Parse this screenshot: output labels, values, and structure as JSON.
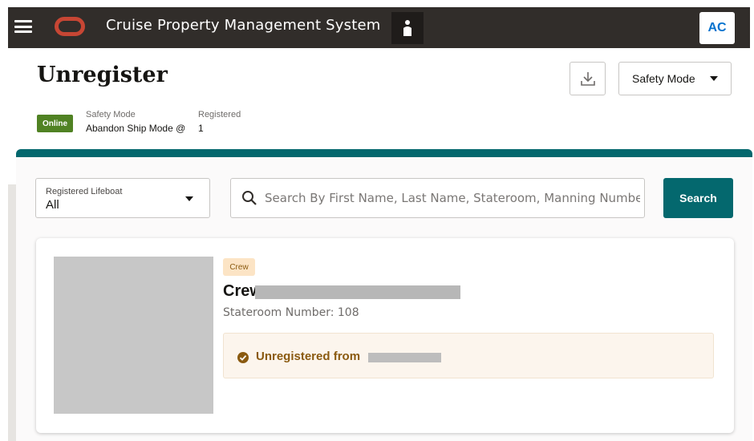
{
  "header": {
    "app_title": "Cruise Property Management System",
    "menu_icon": "hamburger-menu-icon",
    "logo_icon": "oracle-logo-icon",
    "person_icon": "person-icon",
    "user_initials": "AC"
  },
  "page": {
    "title": "Unregister",
    "download_icon": "download-icon",
    "safety_mode_button": "Safety Mode"
  },
  "status": {
    "online_badge": "Online",
    "safety_mode_label": "Safety Mode",
    "safety_mode_value": "Abandon Ship Mode @",
    "registered_label": "Registered",
    "registered_value": "1"
  },
  "filters": {
    "lifeboat_label": "Registered Lifeboat",
    "lifeboat_value": "All",
    "search_placeholder": "Search By First Name, Last Name, Stateroom, Manning Number, Nationality",
    "search_button": "Search"
  },
  "person_card": {
    "badge": "Crew",
    "name": "Crew",
    "stateroom": "Stateroom Number: 108",
    "notice_message": "Unregistered from"
  },
  "colors": {
    "header_bg": "#312d2a",
    "accent_teal": "#04686e",
    "online_green": "#508223",
    "oracle_red": "#c74634",
    "warning_text": "#8a5a10"
  }
}
